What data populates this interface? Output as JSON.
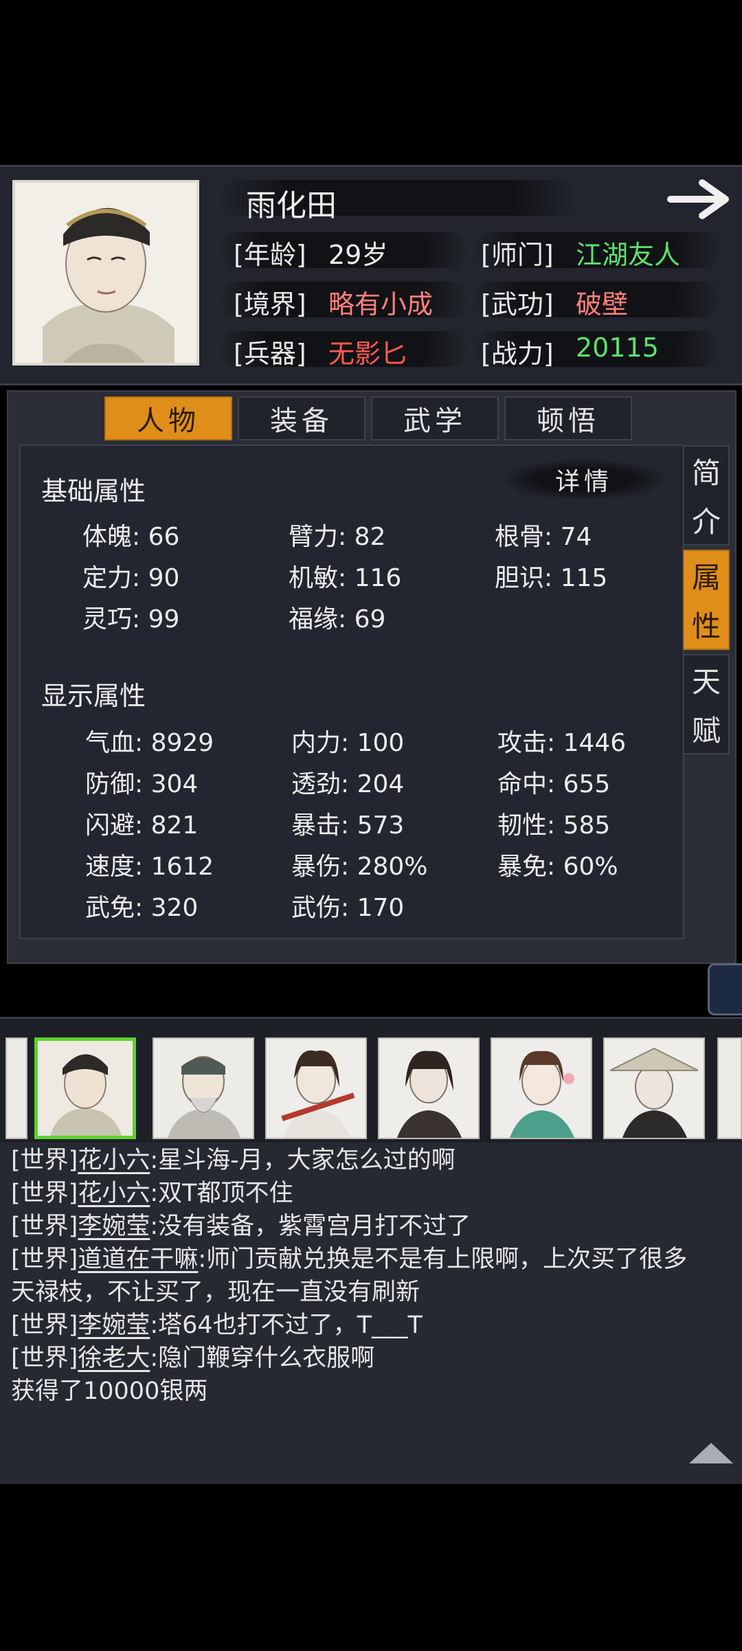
{
  "profile": {
    "name": "雨化田",
    "rows": [
      {
        "k1": "[年龄]",
        "v1": "29岁",
        "k2": "[师门]",
        "v2": "江湖友人"
      },
      {
        "k1": "[境界]",
        "v1": "略有小成",
        "k2": "[武功]",
        "v2": "破壁"
      },
      {
        "k1": "[兵器]",
        "v1": "无影匕",
        "k2": "[战力]",
        "v2": "20115"
      }
    ]
  },
  "tabs": [
    "人物",
    "装备",
    "武学",
    "顿悟"
  ],
  "detail_label": "详情",
  "side_tabs": [
    {
      "c1": "简",
      "c2": "介"
    },
    {
      "c1": "属",
      "c2": "性"
    },
    {
      "c1": "天",
      "c2": "赋"
    }
  ],
  "basic": {
    "title": "基础属性",
    "stats": [
      "体魄: 66",
      "臂力: 82",
      "根骨: 74",
      "定力: 90",
      "机敏: 116",
      "胆识: 115",
      "灵巧: 99",
      "福缘: 69"
    ]
  },
  "display": {
    "title": "显示属性",
    "stats": [
      "气血: 8929",
      "内力: 100",
      "攻击: 1446",
      "防御: 304",
      "透劲: 204",
      "命中: 655",
      "闪避: 821",
      "暴击: 573",
      "韧性: 585",
      "速度: 1612",
      "暴伤: 280%",
      "暴免: 60%",
      "武免: 320",
      "武伤: 170"
    ]
  },
  "chat": [
    {
      "tag": "[世界]",
      "user": "花小六",
      "msg": ":星斗海-月，大家怎么过的啊"
    },
    {
      "tag": "[世界]",
      "user": "花小六",
      "msg": ":双T都顶不住"
    },
    {
      "tag": "[世界]",
      "user": "李婉莹",
      "msg": ":没有装备，紫霄宫月打不过了"
    },
    {
      "tag": "[世界]",
      "user": "道道在干嘛",
      "msg": ":师门贡献兑换是不是有上限啊，上次买了很多"
    },
    {
      "tag": "",
      "user": "",
      "msg": "天禄枝，不让买了，现在一直没有刷新"
    },
    {
      "tag": "[世界]",
      "user": "李婉莹",
      "msg": ":塔64也打不过了，T___T"
    },
    {
      "tag": "[世界]",
      "user": "徐老大",
      "msg": ":隐门鞭穿什么衣服啊"
    },
    {
      "tag": "",
      "user": "",
      "msg": "获得了10000银两"
    }
  ],
  "icons": {
    "next": "arrow-right-icon",
    "scroll": "triangle-up-icon"
  }
}
